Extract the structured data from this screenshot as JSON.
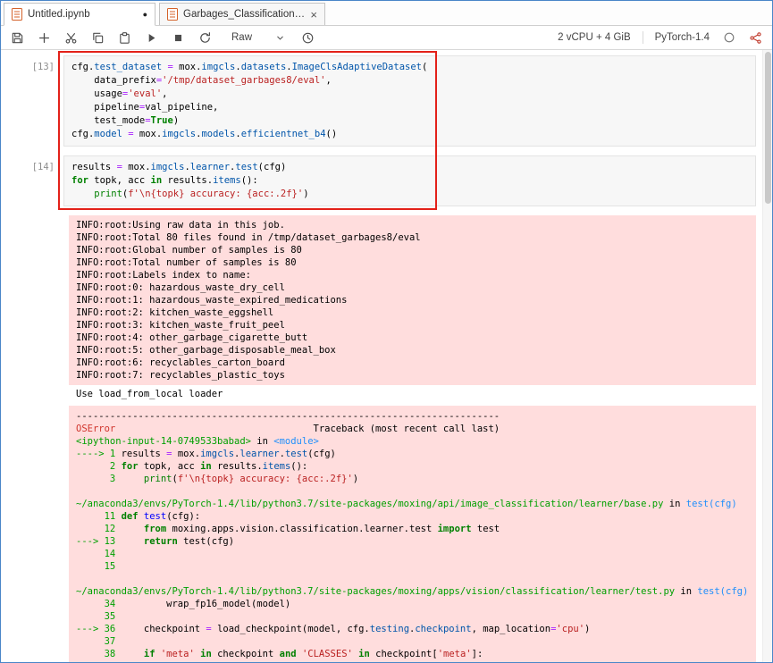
{
  "tabbar": {
    "tabs": [
      {
        "label": "Untitled.ipynb",
        "indicator": "●",
        "active": true
      },
      {
        "label": "Garbages_Classification.ipynl",
        "indicator": "×",
        "active": false
      }
    ]
  },
  "toolbar": {
    "cell_type": "Raw",
    "resources": "2 vCPU + 4 GiB",
    "kernel": "PyTorch-1.4",
    "icons": [
      "save-icon",
      "add-cell-icon",
      "cut-icon",
      "copy-icon",
      "paste-icon",
      "run-icon",
      "stop-icon",
      "restart-icon",
      "chevron-down-icon",
      "clock-icon",
      "status-circle-icon",
      "share-icon"
    ]
  },
  "notebook": {
    "cells": [
      {
        "prompt": "[13]",
        "lines": [
          [
            [
              "p",
              "cfg."
            ],
            [
              "a",
              "test_dataset"
            ],
            [
              "p",
              " "
            ],
            [
              "o",
              "="
            ],
            [
              "p",
              " mox."
            ],
            [
              "a",
              "imgcls"
            ],
            [
              "p",
              "."
            ],
            [
              "a",
              "datasets"
            ],
            [
              "p",
              "."
            ],
            [
              "a",
              "ImageClsAdaptiveDataset"
            ],
            [
              "p",
              "("
            ]
          ],
          [
            [
              "p",
              "    data_prefix"
            ],
            [
              "o",
              "="
            ],
            [
              "s",
              "'/tmp/dataset_garbages8/eval'"
            ],
            [
              "p",
              ","
            ]
          ],
          [
            [
              "p",
              "    usage"
            ],
            [
              "o",
              "="
            ],
            [
              "s",
              "'eval'"
            ],
            [
              "p",
              ","
            ]
          ],
          [
            [
              "p",
              "    pipeline"
            ],
            [
              "o",
              "="
            ],
            [
              "p",
              "val_pipeline,"
            ]
          ],
          [
            [
              "p",
              "    test_mode"
            ],
            [
              "o",
              "="
            ],
            [
              "k",
              "True"
            ],
            [
              "p",
              ")"
            ]
          ],
          [
            [
              "p",
              "cfg."
            ],
            [
              "a",
              "model"
            ],
            [
              "p",
              " "
            ],
            [
              "o",
              "="
            ],
            [
              "p",
              " mox."
            ],
            [
              "a",
              "imgcls"
            ],
            [
              "p",
              "."
            ],
            [
              "a",
              "models"
            ],
            [
              "p",
              "."
            ],
            [
              "a",
              "efficientnet_b4"
            ],
            [
              "p",
              "()"
            ]
          ]
        ]
      },
      {
        "prompt": "[14]",
        "lines": [
          [
            [
              "p",
              "results "
            ],
            [
              "o",
              "="
            ],
            [
              "p",
              " mox."
            ],
            [
              "a",
              "imgcls"
            ],
            [
              "p",
              "."
            ],
            [
              "a",
              "learner"
            ],
            [
              "p",
              "."
            ],
            [
              "a",
              "test"
            ],
            [
              "p",
              "(cfg)"
            ]
          ],
          [
            [
              "k",
              "for"
            ],
            [
              "p",
              " topk, acc "
            ],
            [
              "k",
              "in"
            ],
            [
              "p",
              " results."
            ],
            [
              "a",
              "items"
            ],
            [
              "p",
              "():"
            ]
          ],
          [
            [
              "p",
              "    "
            ],
            [
              "b",
              "print"
            ],
            [
              "p",
              "("
            ],
            [
              "s",
              "f'\\n{topk} accuracy: {acc:.2f}'"
            ],
            [
              "p",
              ")"
            ]
          ]
        ]
      }
    ],
    "outputs": {
      "stderr_lines": [
        "INFO:root:Using raw data in this job.",
        "INFO:root:Total 80 files found in /tmp/dataset_garbages8/eval",
        "INFO:root:Global number of samples is 80",
        "INFO:root:Total number of samples is 80",
        "INFO:root:Labels index to name:",
        "INFO:root:0: hazardous_waste_dry_cell",
        "INFO:root:1: hazardous_waste_expired_medications",
        "INFO:root:2: kitchen_waste_eggshell",
        "INFO:root:3: kitchen_waste_fruit_peel",
        "INFO:root:4: other_garbage_cigarette_butt",
        "INFO:root:5: other_garbage_disposable_meal_box",
        "INFO:root:6: recyclables_carton_board",
        "INFO:root:7: recyclables_plastic_toys"
      ],
      "stdout_line": "Use load_from_local loader",
      "traceback_lines": [
        [
          [
            "p",
            "---------------------------------------------------------------------------"
          ]
        ],
        [
          [
            "r",
            "OSError"
          ],
          [
            "p",
            "                                   Traceback (most recent call last)"
          ]
        ],
        [
          [
            "g",
            "<ipython-input-14-0749533babad>"
          ],
          [
            "p",
            " in "
          ],
          [
            "c",
            "<module>"
          ]
        ],
        [
          [
            "g",
            "----> 1"
          ],
          [
            "p",
            " results "
          ],
          [
            "o",
            "="
          ],
          [
            "p",
            " mox."
          ],
          [
            "a",
            "imgcls"
          ],
          [
            "p",
            "."
          ],
          [
            "a",
            "learner"
          ],
          [
            "p",
            "."
          ],
          [
            "a",
            "test"
          ],
          [
            "p",
            "(cfg)"
          ]
        ],
        [
          [
            "g",
            "      2"
          ],
          [
            "p",
            " "
          ],
          [
            "k",
            "for"
          ],
          [
            "p",
            " topk, acc "
          ],
          [
            "k",
            "in"
          ],
          [
            "p",
            " results."
          ],
          [
            "a",
            "items"
          ],
          [
            "p",
            "():"
          ]
        ],
        [
          [
            "g",
            "      3"
          ],
          [
            "p",
            "     "
          ],
          [
            "b",
            "print"
          ],
          [
            "p",
            "("
          ],
          [
            "s",
            "f'\\n{topk} accuracy: {acc:.2f}'"
          ],
          [
            "p",
            ")"
          ]
        ],
        [],
        [
          [
            "g",
            "~/anaconda3/envs/PyTorch-1.4/lib/python3.7/site-packages/moxing/api/image_classification/learner/base.py"
          ],
          [
            "p",
            " in "
          ],
          [
            "c",
            "test(cfg)"
          ]
        ],
        [
          [
            "g",
            "     11"
          ],
          [
            "p",
            " "
          ],
          [
            "k",
            "def"
          ],
          [
            "p",
            " "
          ],
          [
            "d",
            "test"
          ],
          [
            "p",
            "(cfg):"
          ]
        ],
        [
          [
            "g",
            "     12"
          ],
          [
            "p",
            "     "
          ],
          [
            "k",
            "from"
          ],
          [
            "p",
            " moxing.apps.vision.classification.learner.test "
          ],
          [
            "k",
            "import"
          ],
          [
            "p",
            " test"
          ]
        ],
        [
          [
            "g",
            "---> 13"
          ],
          [
            "p",
            "     "
          ],
          [
            "k",
            "return"
          ],
          [
            "p",
            " test(cfg)"
          ]
        ],
        [
          [
            "g",
            "     14"
          ]
        ],
        [
          [
            "g",
            "     15"
          ]
        ],
        [],
        [
          [
            "g",
            "~/anaconda3/envs/PyTorch-1.4/lib/python3.7/site-packages/moxing/apps/vision/classification/learner/test.py"
          ],
          [
            "p",
            " in "
          ],
          [
            "c",
            "test(cfg)"
          ]
        ],
        [
          [
            "g",
            "     34"
          ],
          [
            "p",
            "         wrap_fp16_model(model)"
          ]
        ],
        [
          [
            "g",
            "     35"
          ]
        ],
        [
          [
            "g",
            "---> 36"
          ],
          [
            "p",
            "     checkpoint "
          ],
          [
            "o",
            "="
          ],
          [
            "p",
            " load_checkpoint(model, cfg."
          ],
          [
            "a",
            "testing"
          ],
          [
            "p",
            "."
          ],
          [
            "a",
            "checkpoint"
          ],
          [
            "p",
            ", map_location"
          ],
          [
            "o",
            "="
          ],
          [
            "s",
            "'cpu'"
          ],
          [
            "p",
            ")"
          ]
        ],
        [
          [
            "g",
            "     37"
          ]
        ],
        [
          [
            "g",
            "     38"
          ],
          [
            "p",
            "     "
          ],
          [
            "k",
            "if"
          ],
          [
            "p",
            " "
          ],
          [
            "s",
            "'meta'"
          ],
          [
            "p",
            " "
          ],
          [
            "k",
            "in"
          ],
          [
            "p",
            " checkpoint "
          ],
          [
            "k",
            "and"
          ],
          [
            "p",
            " "
          ],
          [
            "s",
            "'CLASSES'"
          ],
          [
            "p",
            " "
          ],
          [
            "k",
            "in"
          ],
          [
            "p",
            " checkpoint["
          ],
          [
            "s",
            "'meta'"
          ],
          [
            "p",
            "]:"
          ]
        ]
      ]
    }
  },
  "annotation_color": "#e32119"
}
